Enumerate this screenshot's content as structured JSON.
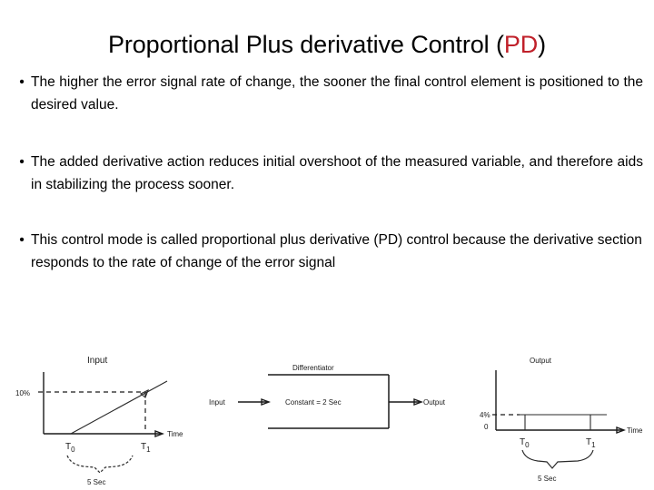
{
  "slide": {
    "title_main": "Proportional Plus derivative Control (",
    "title_accent": "PD",
    "title_close": ")",
    "accent_color": "#C0202A",
    "bullet_marker": "•"
  },
  "bullets": [
    {
      "text": "The higher the error signal rate of change, the sooner the final control element is positioned to the desired value."
    },
    {
      "text": "The added derivative action reduces initial overshoot of the measured variable, and therefore aids in stabilizing the process sooner."
    },
    {
      "text": "This control mode is called proportional plus derivative (PD) control because the derivative section responds to the rate of change of the error signal"
    }
  ],
  "figure": {
    "input_chart": {
      "title": "Input",
      "y_label": "10%",
      "x_label": "Time",
      "tick_t0": "T",
      "tick_t0_sub": "0",
      "tick_t1": "T",
      "tick_t1_sub": "1",
      "brace_label": "5  Sec"
    },
    "differentiator_block": {
      "title": "Differentiator",
      "box_text": "Constant  =  2  Sec",
      "input_label": "Input",
      "output_label": "Output"
    },
    "output_chart": {
      "title": "Output",
      "y_label": "4%",
      "y_zero": "0",
      "x_label": "Time",
      "tick_t0": "T",
      "tick_t0_sub": "0",
      "tick_t1": "T",
      "tick_t1_sub": "1",
      "brace_label": "5  Sec"
    }
  }
}
